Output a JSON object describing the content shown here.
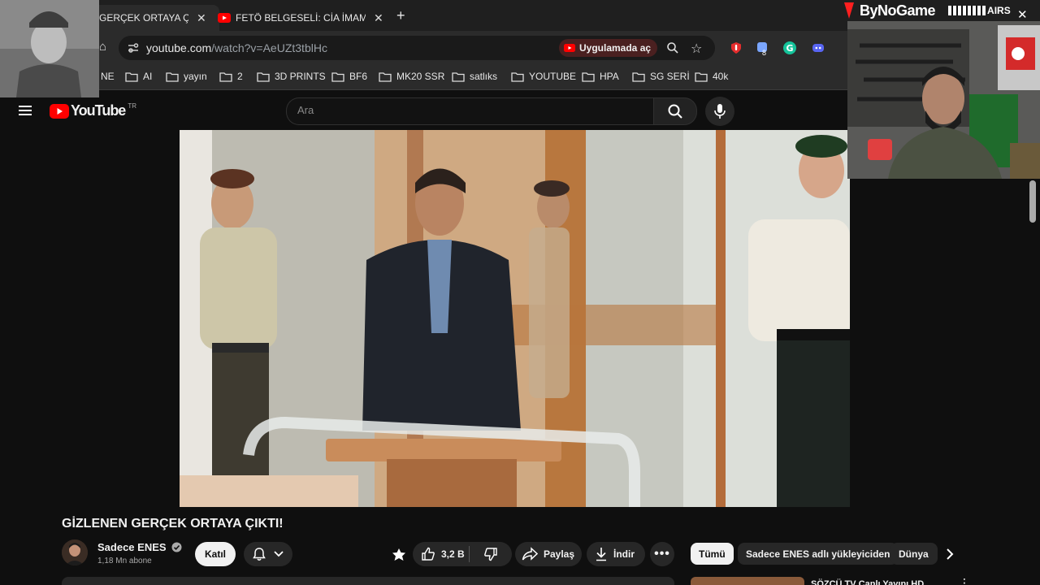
{
  "browser": {
    "tabs": [
      {
        "title": "GERÇEK ORTAYA ÇIK",
        "active": true
      },
      {
        "title": "FETÖ BELGESELİ: CİA İMAMI - Y",
        "active": false
      }
    ],
    "new_tab_label": "+",
    "url_host": "youtube.com",
    "url_path": "/watch?v=AeUZt3tblHc",
    "open_in_app": "Uygulamada aç",
    "extension_badge": "8",
    "bookmarks": [
      "NE",
      "AI",
      "yayın",
      "2",
      "3D PRINTS",
      "BF6",
      "MK20 SSR",
      "satlıks",
      "YOUTUBE",
      "HPA",
      "SG SERİ",
      "40k"
    ]
  },
  "youtube": {
    "logo_text": "YouTube",
    "country_code": "TR",
    "search_placeholder": "Ara"
  },
  "overlay": {
    "brand_name": "ByNoGame",
    "brand_sub": "AIRS"
  },
  "video": {
    "title": "GİZLENEN GERÇEK ORTAYA ÇIKTI!",
    "channel_name": "Sadece ENES",
    "subscribers": "1,18 Mn abone",
    "join_label": "Katıl",
    "likes": "3,2 B",
    "share_label": "Paylaş",
    "download_label": "İndir"
  },
  "filters": {
    "chips": [
      "Tümü",
      "Sadece ENES adlı yükleyiciden",
      "Dünya"
    ]
  },
  "up_next": {
    "title_partial": "SÖZCÜ TV Canlı Yayını HD"
  },
  "colors": {
    "background": "#0f0f0f",
    "youtube_red": "#ff0000",
    "pill": "#272727",
    "chip_active": "#f1f1f1"
  }
}
